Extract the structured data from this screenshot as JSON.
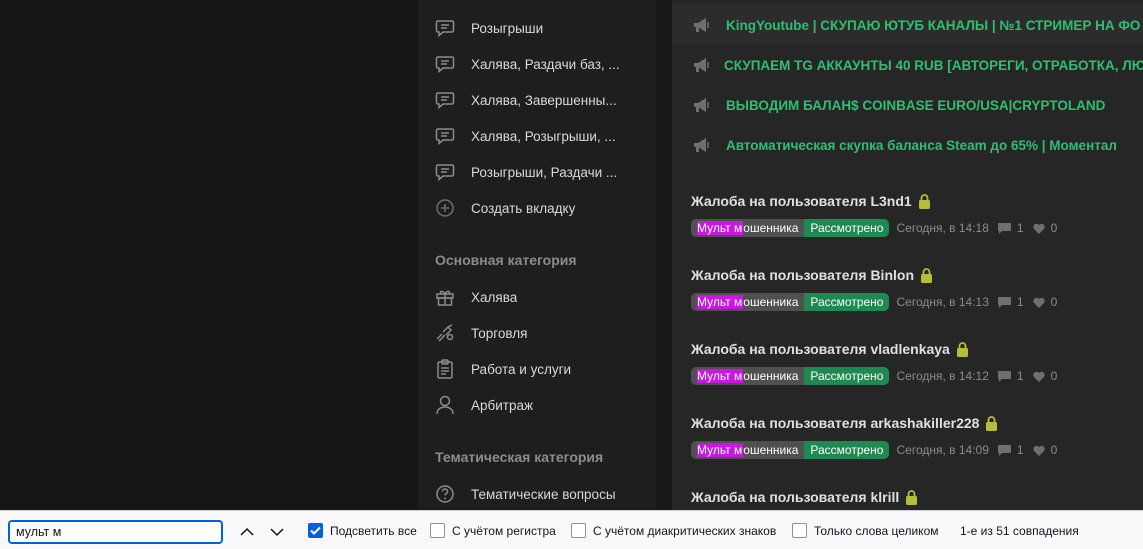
{
  "sidebar": {
    "items": [
      {
        "label": "Розыгрыши",
        "icon": "chat-icon"
      },
      {
        "label": "Халява, Раздачи баз, ...",
        "icon": "chat-icon"
      },
      {
        "label": "Халява, Завершенны...",
        "icon": "chat-icon"
      },
      {
        "label": "Халява, Розыгрыши, ...",
        "icon": "chat-icon"
      },
      {
        "label": "Розыгрыши, Раздачи ...",
        "icon": "chat-icon"
      },
      {
        "label": "Создать вкладку",
        "icon": "plus-circle-icon"
      }
    ],
    "main_heading": "Основная категория",
    "main_items": [
      {
        "label": "Халява",
        "icon": "gift-icon"
      },
      {
        "label": "Торговля",
        "icon": "handshake-icon"
      },
      {
        "label": "Работа и услуги",
        "icon": "clipboard-icon"
      },
      {
        "label": "Арбитраж",
        "icon": "user-icon"
      }
    ],
    "thematic_heading": "Тематическая категория",
    "thematic_items": [
      {
        "label": "Тематические вопросы",
        "icon": "question-icon"
      }
    ]
  },
  "pinned": [
    "KingYoutube | СКУПАЮ ЮТУБ КАНАЛЫ | №1 СТРИМЕР НА ФО",
    "СКУПАЕМ TG АККАУНТЫ 40 RUB [АВТОРЕГИ, ОТРАБОТКА, ЛЮ",
    "ВЫВОДИМ БАЛАН$ COINBASE EURO/USA|CRYPTOLAND",
    "Автоматическая скупка баланса Steam до 65% | Моментал"
  ],
  "threads": [
    {
      "title": "Жалоба на пользователя L3nd1",
      "prefix_hl": "Мульт м",
      "prefix_rest": "ошенника",
      "status": "Рассмотрено",
      "time": "Сегодня, в 14:18",
      "replies": "1",
      "likes": "0"
    },
    {
      "title": "Жалоба на пользователя Binlon",
      "prefix_hl": "Мульт м",
      "prefix_rest": "ошенника",
      "status": "Рассмотрено",
      "time": "Сегодня, в 14:13",
      "replies": "1",
      "likes": "0"
    },
    {
      "title": "Жалоба на пользователя vladlenkaya",
      "prefix_hl": "Мульт м",
      "prefix_rest": "ошенника",
      "status": "Рассмотрено",
      "time": "Сегодня, в 14:12",
      "replies": "1",
      "likes": "0"
    },
    {
      "title": "Жалоба на пользователя arkashakiller228",
      "prefix_hl": "Мульт м",
      "prefix_rest": "ошенника",
      "status": "Рассмотрено",
      "time": "Сегодня, в 14:09",
      "replies": "1",
      "likes": "0"
    },
    {
      "title": "Жалоба на пользователя klrill"
    }
  ],
  "findbar": {
    "query": "мульт м",
    "highlight_all": "Подсветить все",
    "match_case": "С учётом регистра",
    "diacritics": "С учётом диакритических знаков",
    "whole_words": "Только слова целиком",
    "status": "1-е из 51 совпадения"
  },
  "colors": {
    "accent_green": "#2fbf71",
    "status_green": "#1e8a52",
    "highlight": "#c918e3",
    "lock": "#b5bd3a",
    "find_accent": "#0061e0"
  }
}
